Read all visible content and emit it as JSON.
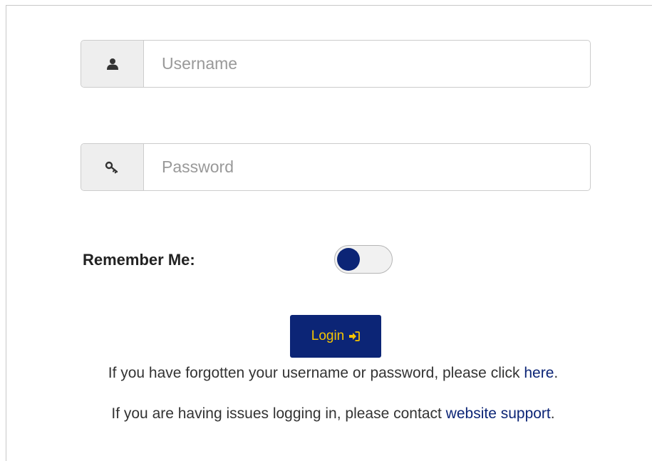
{
  "form": {
    "username": {
      "placeholder": "Username",
      "value": "",
      "icon": "user-icon"
    },
    "password": {
      "placeholder": "Password",
      "value": "",
      "icon": "key-icon"
    },
    "remember": {
      "label": "Remember Me:",
      "checked": false
    },
    "login_button": {
      "label": "Login",
      "icon": "sign-in-icon"
    }
  },
  "help": {
    "forgot": {
      "text": "If you have forgotten your username or password, please click ",
      "link_text": "here",
      "suffix": "."
    },
    "issues": {
      "text": "If you are having issues logging in, please contact ",
      "link_text": "website support",
      "suffix": "."
    }
  },
  "colors": {
    "brand_navy": "#0c2576",
    "button_text": "#f5c400",
    "addon_bg": "#eeeeee",
    "placeholder": "#999999"
  }
}
